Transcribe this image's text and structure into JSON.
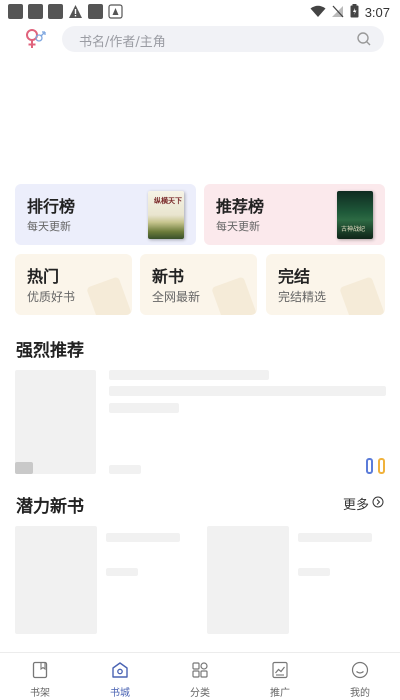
{
  "status_bar": {
    "time": "3:07"
  },
  "header": {
    "search_placeholder": "书名/作者/主角"
  },
  "rank_cards": [
    {
      "title": "排行榜",
      "subtitle": "每天更新",
      "cover_text": "纵横天下"
    },
    {
      "title": "推荐榜",
      "subtitle": "每天更新",
      "cover_text": "古神战纪"
    }
  ],
  "category_cards": [
    {
      "title": "热门",
      "subtitle": "优质好书"
    },
    {
      "title": "新书",
      "subtitle": "全网最新"
    },
    {
      "title": "完结",
      "subtitle": "完结精选"
    }
  ],
  "sections": {
    "strong_recommend": {
      "title": "强烈推荐"
    },
    "potential_new": {
      "title": "潜力新书",
      "more_label": "更多"
    }
  },
  "bottom_nav": [
    {
      "label": "书架",
      "icon": "bookshelf-icon",
      "active": false
    },
    {
      "label": "书城",
      "icon": "bookstore-icon",
      "active": true
    },
    {
      "label": "分类",
      "icon": "category-icon",
      "active": false
    },
    {
      "label": "推广",
      "icon": "promotion-icon",
      "active": false
    },
    {
      "label": "我的",
      "icon": "profile-icon",
      "active": false
    }
  ],
  "colors": {
    "accent": "#4a63b3",
    "indicator_blue": "#5b7cd9",
    "indicator_orange": "#f0b23c"
  }
}
